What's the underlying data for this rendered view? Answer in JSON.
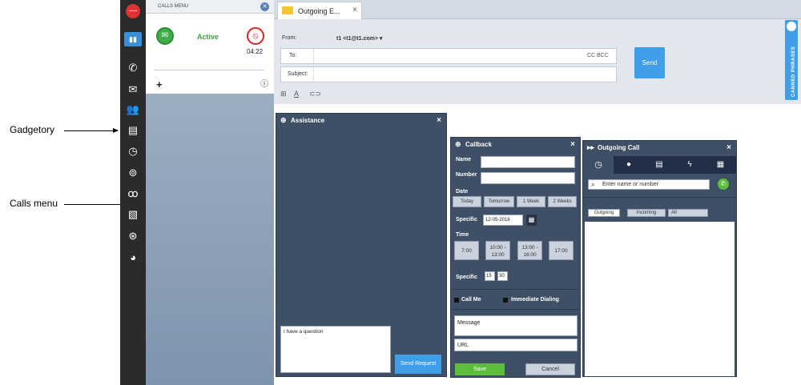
{
  "annotations": {
    "gadgetory": "Gadgetory",
    "calls_menu": "Calls menu"
  },
  "calls_menu": {
    "title": "CALLS MENU",
    "status": "Active",
    "timer": "04:22",
    "add_symbol": "+",
    "info_symbol": "ⓘ"
  },
  "email": {
    "tab_label": "Outgoing E...",
    "tab_close": "×",
    "from_label": "From:",
    "from_value": "t1 <t1@t1.com> ▾",
    "to_label": "To:",
    "cc_bcc": "CC BCC",
    "subject_label": "Subject:",
    "send_label": "Send",
    "canned_phrases": "CANNED PHRASES"
  },
  "assistance": {
    "title": "Assistance",
    "close": "×",
    "message_value": "I have a question",
    "send_request_label": "Send Request"
  },
  "callback": {
    "title": "Callback",
    "close": "×",
    "name_label": "Name",
    "number_label": "Number",
    "date_label": "Date",
    "date_options": [
      "Today",
      "Tomorrow",
      "1 Week",
      "2 Weeks"
    ],
    "specific_label": "Specific",
    "specific_date": "12-05-2018",
    "time_label": "Time",
    "time_options": [
      [
        "7:00"
      ],
      [
        "10:00 -",
        "13:00"
      ],
      [
        "13:00 -",
        "16:00"
      ],
      [
        "17:00"
      ]
    ],
    "specific_time_label": "Specific",
    "hour": "15",
    "minute": "30",
    "call_me": "Call Me",
    "immediate_dialing": "Immediate Dialing",
    "message_placeholder": "Message",
    "url_placeholder": "URL",
    "save_label": "Save",
    "cancel_label": "Cancel"
  },
  "outgoing_call": {
    "title": "Outgoing Call",
    "close": "×",
    "search_placeholder": "Enter name or number",
    "filters": [
      "Outgoing",
      "Incoming",
      "All"
    ]
  }
}
